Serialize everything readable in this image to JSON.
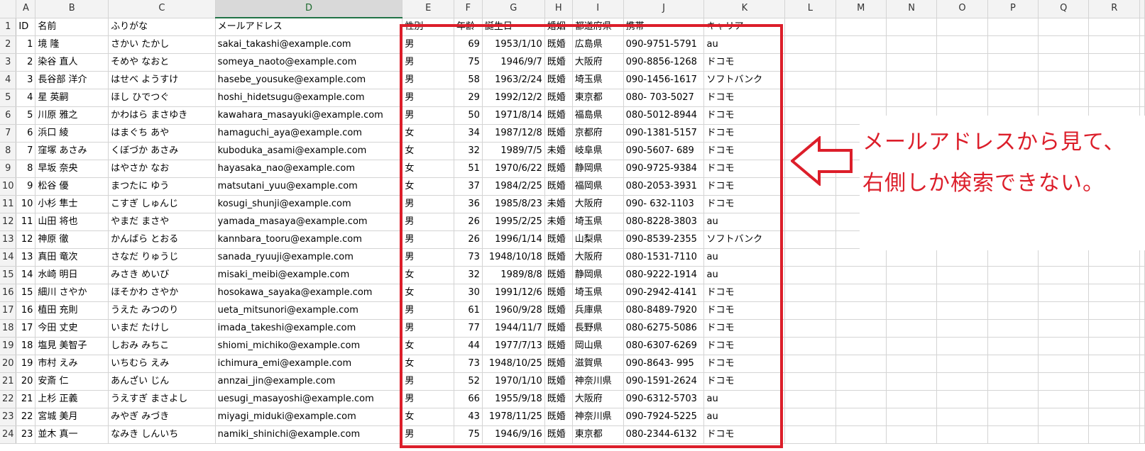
{
  "columns": [
    "A",
    "B",
    "C",
    "D",
    "E",
    "F",
    "G",
    "H",
    "I",
    "J",
    "K",
    "L",
    "M",
    "N",
    "O",
    "P",
    "Q",
    "R"
  ],
  "header_row": [
    "ID",
    "名前",
    "ふりがな",
    "メールアドレス",
    "性別",
    "年齢",
    "誕生日",
    "婚姻",
    "都道府県",
    "携帯",
    "キャリア"
  ],
  "rows": [
    [
      "1",
      "境 隆",
      "さかい たかし",
      "sakai_takashi@example.com",
      "男",
      "69",
      "1953/1/10",
      "既婚",
      "広島県",
      "090-9751-5791",
      "au"
    ],
    [
      "2",
      "染谷 直人",
      "そめや なおと",
      "someya_naoto@example.com",
      "男",
      "75",
      "1946/9/7",
      "既婚",
      "大阪府",
      "090-8856-1268",
      "ドコモ"
    ],
    [
      "3",
      "長谷部 洋介",
      "はせべ ようすけ",
      "hasebe_yousuke@example.com",
      "男",
      "58",
      "1963/2/24",
      "既婚",
      "埼玉県",
      "090-1456-1617",
      "ソフトバンク"
    ],
    [
      "4",
      "星 英嗣",
      "ほし ひでつぐ",
      "hoshi_hidetsugu@example.com",
      "男",
      "29",
      "1992/12/2",
      "既婚",
      "東京都",
      "080- 703-5027",
      "ドコモ"
    ],
    [
      "5",
      "川原 雅之",
      "かわはら まさゆき",
      "kawahara_masayuki@example.com",
      "男",
      "50",
      "1971/8/14",
      "既婚",
      "福島県",
      "080-5012-8944",
      "ドコモ"
    ],
    [
      "6",
      "浜口 綾",
      "はまぐち あや",
      "hamaguchi_aya@example.com",
      "女",
      "34",
      "1987/12/8",
      "既婚",
      "京都府",
      "090-1381-5157",
      "ドコモ"
    ],
    [
      "7",
      "窪塚 あさみ",
      "くぼづか あさみ",
      "kuboduka_asami@example.com",
      "女",
      "32",
      "1989/7/5",
      "未婚",
      "岐阜県",
      "090-5607- 689",
      "ドコモ"
    ],
    [
      "8",
      "早坂 奈央",
      "はやさか なお",
      "hayasaka_nao@example.com",
      "女",
      "51",
      "1970/6/22",
      "既婚",
      "静岡県",
      "090-9725-9384",
      "ドコモ"
    ],
    [
      "9",
      "松谷 優",
      "まつたに ゆう",
      "matsutani_yuu@example.com",
      "女",
      "37",
      "1984/2/25",
      "既婚",
      "福岡県",
      "080-2053-3931",
      "ドコモ"
    ],
    [
      "10",
      "小杉 隼士",
      "こすぎ しゅんじ",
      "kosugi_shunji@example.com",
      "男",
      "36",
      "1985/8/23",
      "未婚",
      "大阪府",
      "090- 632-1103",
      "ドコモ"
    ],
    [
      "11",
      "山田 将也",
      "やまだ まさや",
      "yamada_masaya@example.com",
      "男",
      "26",
      "1995/2/25",
      "未婚",
      "埼玉県",
      "080-8228-3803",
      "au"
    ],
    [
      "12",
      "神原 徹",
      "かんばら とおる",
      "kannbara_tooru@example.com",
      "男",
      "26",
      "1996/1/14",
      "既婚",
      "山梨県",
      "090-8539-2355",
      "ソフトバンク"
    ],
    [
      "13",
      "真田 竜次",
      "さなだ りゅうじ",
      "sanada_ryuuji@example.com",
      "男",
      "73",
      "1948/10/18",
      "既婚",
      "大阪府",
      "080-1531-7110",
      "au"
    ],
    [
      "14",
      "水崎 明日",
      "みさき めいび",
      "misaki_meibi@example.com",
      "女",
      "32",
      "1989/8/8",
      "既婚",
      "静岡県",
      "080-9222-1914",
      "au"
    ],
    [
      "15",
      "細川 さやか",
      "ほそかわ さやか",
      "hosokawa_sayaka@example.com",
      "女",
      "30",
      "1991/12/6",
      "既婚",
      "埼玉県",
      "090-2942-4141",
      "ドコモ"
    ],
    [
      "16",
      "植田 充則",
      "うえた みつのり",
      "ueta_mitsunori@example.com",
      "男",
      "61",
      "1960/9/28",
      "既婚",
      "兵庫県",
      "080-8489-7920",
      "ドコモ"
    ],
    [
      "17",
      "今田 丈史",
      "いまだ たけし",
      "imada_takeshi@example.com",
      "男",
      "77",
      "1944/11/7",
      "既婚",
      "長野県",
      "080-6275-5086",
      "ドコモ"
    ],
    [
      "18",
      "塩見 美智子",
      "しおみ みちこ",
      "shiomi_michiko@example.com",
      "女",
      "44",
      "1977/7/13",
      "既婚",
      "岡山県",
      "080-6307-6269",
      "ドコモ"
    ],
    [
      "19",
      "市村 えみ",
      "いちむら えみ",
      "ichimura_emi@example.com",
      "女",
      "73",
      "1948/10/25",
      "既婚",
      "滋賀県",
      "090-8643- 995",
      "ドコモ"
    ],
    [
      "20",
      "安斎 仁",
      "あんざい じん",
      "annzai_jin@example.com",
      "男",
      "52",
      "1970/1/10",
      "既婚",
      "神奈川県",
      "090-1591-2624",
      "ドコモ"
    ],
    [
      "21",
      "上杉 正義",
      "うえすぎ まさよし",
      "uesugi_masayoshi@example.com",
      "男",
      "66",
      "1955/9/18",
      "既婚",
      "大阪府",
      "090-6312-5703",
      "au"
    ],
    [
      "22",
      "宮城 美月",
      "みやぎ みづき",
      "miyagi_miduki@example.com",
      "女",
      "43",
      "1978/11/25",
      "既婚",
      "神奈川県",
      "090-7924-5225",
      "au"
    ],
    [
      "23",
      "並木 真一",
      "なみき しんいち",
      "namiki_shinichi@example.com",
      "男",
      "75",
      "1946/9/16",
      "既婚",
      "東京都",
      "080-2344-6132",
      "ドコモ"
    ]
  ],
  "annotation": {
    "line1": "メールアドレスから見て、",
    "line2": "右側しか検索できない。",
    "color": "#dc1e2a"
  },
  "selection": {
    "column": "D"
  }
}
